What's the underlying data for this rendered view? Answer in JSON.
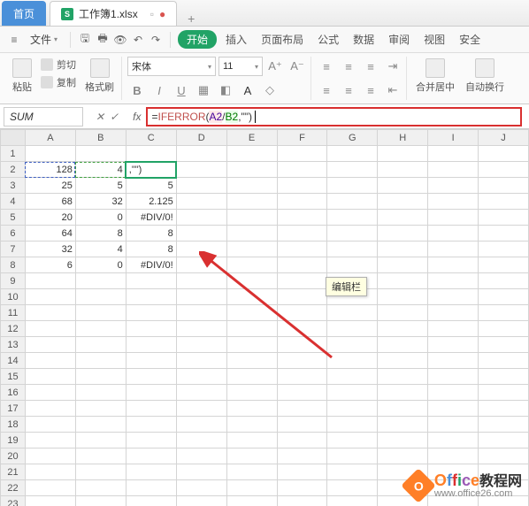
{
  "tabs": {
    "home": "首页",
    "file": "工作簿1.xlsx",
    "add": "+"
  },
  "menubar": {
    "file": "文件",
    "ribbon_tabs": [
      "开始",
      "插入",
      "页面布局",
      "公式",
      "数据",
      "审阅",
      "视图",
      "安全"
    ]
  },
  "ribbon": {
    "paste": "粘贴",
    "cut": "剪切",
    "copy": "复制",
    "format_painter": "格式刷",
    "font_name": "宋体",
    "font_size": "11",
    "merge": "合并居中",
    "wrap": "自动换行"
  },
  "formula_bar": {
    "name_box": "SUM",
    "fx": "fx",
    "formula_prefix": "=",
    "formula_fn": "IFERROR",
    "formula_open": "(",
    "formula_ref1": "A2",
    "formula_div": "/",
    "formula_ref2": "B2",
    "formula_tail": ",\"\")",
    "tooltip": "编辑栏"
  },
  "grid": {
    "cols": [
      "A",
      "B",
      "C",
      "D",
      "E",
      "F",
      "G",
      "H",
      "I",
      "J"
    ],
    "rows": [
      {
        "n": 1,
        "A": "",
        "B": "",
        "C": ""
      },
      {
        "n": 2,
        "A": "128",
        "B": "4",
        "C": ",\"\")"
      },
      {
        "n": 3,
        "A": "25",
        "B": "5",
        "C": "5"
      },
      {
        "n": 4,
        "A": "68",
        "B": "32",
        "C": "2.125"
      },
      {
        "n": 5,
        "A": "20",
        "B": "0",
        "C": "#DIV/0!"
      },
      {
        "n": 6,
        "A": "64",
        "B": "8",
        "C": "8"
      },
      {
        "n": 7,
        "A": "32",
        "B": "4",
        "C": "8"
      },
      {
        "n": 8,
        "A": "6",
        "B": "0",
        "C": "#DIV/0!"
      },
      {
        "n": 9
      },
      {
        "n": 10
      },
      {
        "n": 11
      },
      {
        "n": 12
      },
      {
        "n": 13
      },
      {
        "n": 14
      },
      {
        "n": 15
      },
      {
        "n": 16
      },
      {
        "n": 17
      },
      {
        "n": 18
      },
      {
        "n": 19
      },
      {
        "n": 20
      },
      {
        "n": 21
      },
      {
        "n": 22
      },
      {
        "n": 23
      }
    ]
  },
  "watermark": {
    "brand": "Office",
    "brand_cn": "教程网",
    "url": "www.office26.com"
  }
}
